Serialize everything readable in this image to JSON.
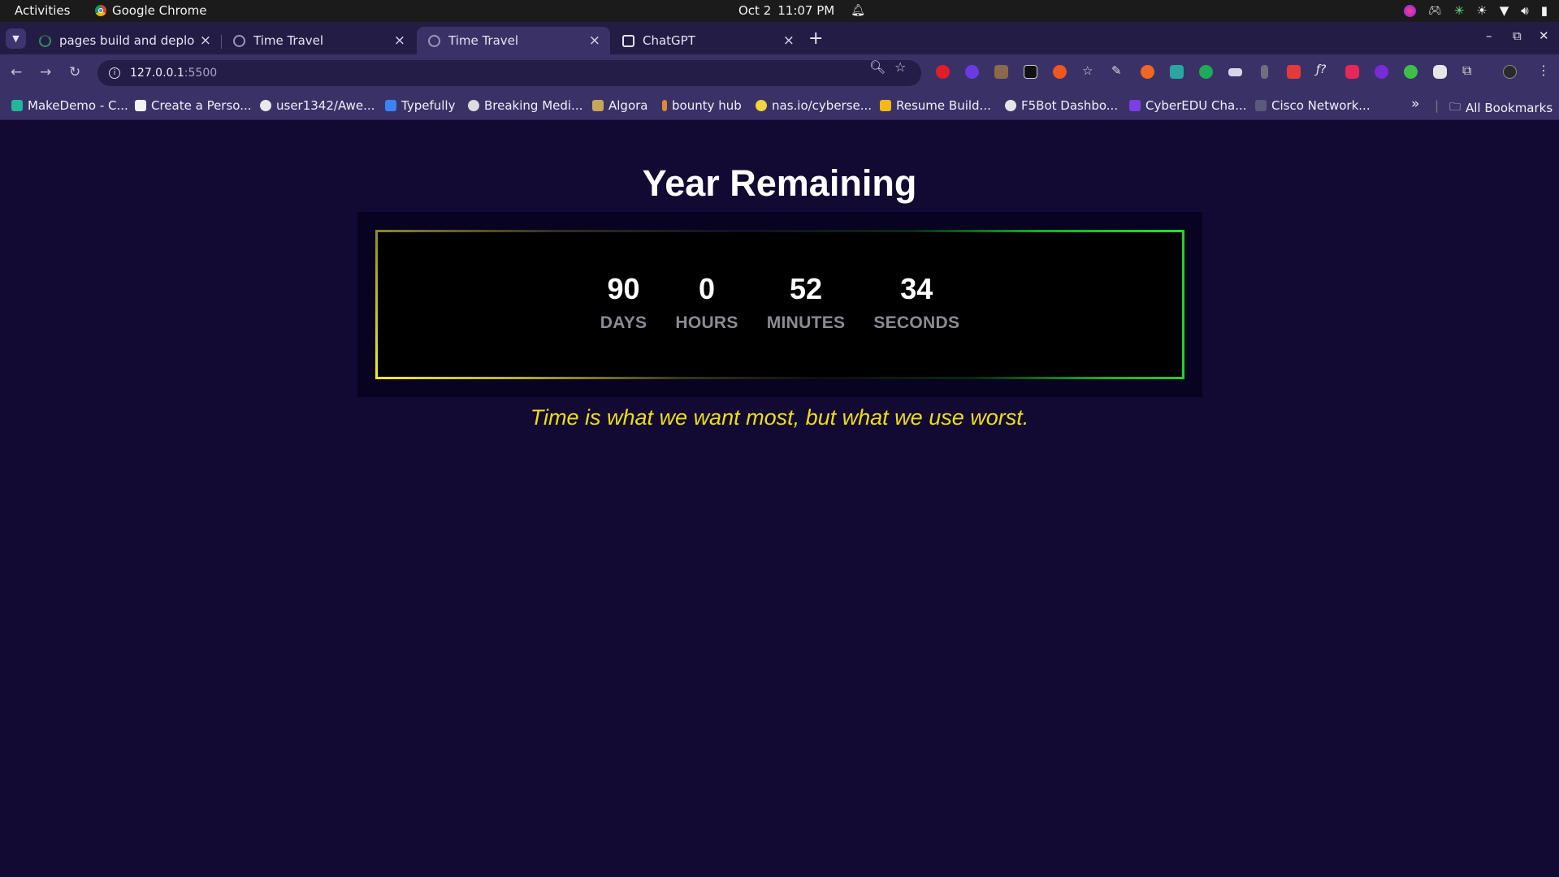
{
  "system_bar": {
    "activities": "Activities",
    "app_name": "Google Chrome",
    "date": "Oct 2",
    "time": "11:07 PM"
  },
  "tabs": [
    {
      "title": "pages build and deploym",
      "active": false
    },
    {
      "title": "Time Travel",
      "active": false
    },
    {
      "title": "Time Travel",
      "active": true
    },
    {
      "title": "ChatGPT",
      "active": false
    }
  ],
  "tab_close_glyph": "×",
  "new_tab_glyph": "+",
  "address_bar": {
    "host": "127.0.0.1",
    "port": ":5500"
  },
  "bookmarks": [
    {
      "label": "MakeDemo - C...",
      "icon_color": "#1fb89a"
    },
    {
      "label": "Create a Perso...",
      "icon_color": "#f4f4f4"
    },
    {
      "label": "user1342/Awe...",
      "icon_color": "#e8e8e8"
    },
    {
      "label": "Typefully",
      "icon_color": "#3b82f6"
    },
    {
      "label": "Breaking Medi...",
      "icon_color": "#dcdcdc"
    },
    {
      "label": "Algora",
      "icon_color": "#c7a55a"
    },
    {
      "label": "bounty hub",
      "icon_color": "#e08a2c"
    },
    {
      "label": "nas.io/cyberse...",
      "icon_color": "#f2d43b"
    },
    {
      "label": "Resume Build...",
      "icon_color": "#f5b915"
    },
    {
      "label": "F5Bot Dashbo...",
      "icon_color": "#e6e6e6"
    },
    {
      "label": "CyberEDU Cha...",
      "icon_color": "#7b3fe4"
    },
    {
      "label": "Cisco Network...",
      "icon_color": "#5a5a7a"
    }
  ],
  "bookmarks_overflow": "»",
  "all_bookmarks": "All Bookmarks",
  "page": {
    "title": "Year Remaining",
    "countdown": [
      {
        "value": "90",
        "label": "DAYS"
      },
      {
        "value": "0",
        "label": "HOURS"
      },
      {
        "value": "52",
        "label": "MINUTES"
      },
      {
        "value": "34",
        "label": "SECONDS"
      }
    ],
    "quote": "Time is what we want most, but what we use worst."
  },
  "colors": {
    "page_background": "#130a33",
    "quote": "#ecdd1a",
    "frame_green": "#22cf2a",
    "frame_yellow": "#f2ef24"
  }
}
